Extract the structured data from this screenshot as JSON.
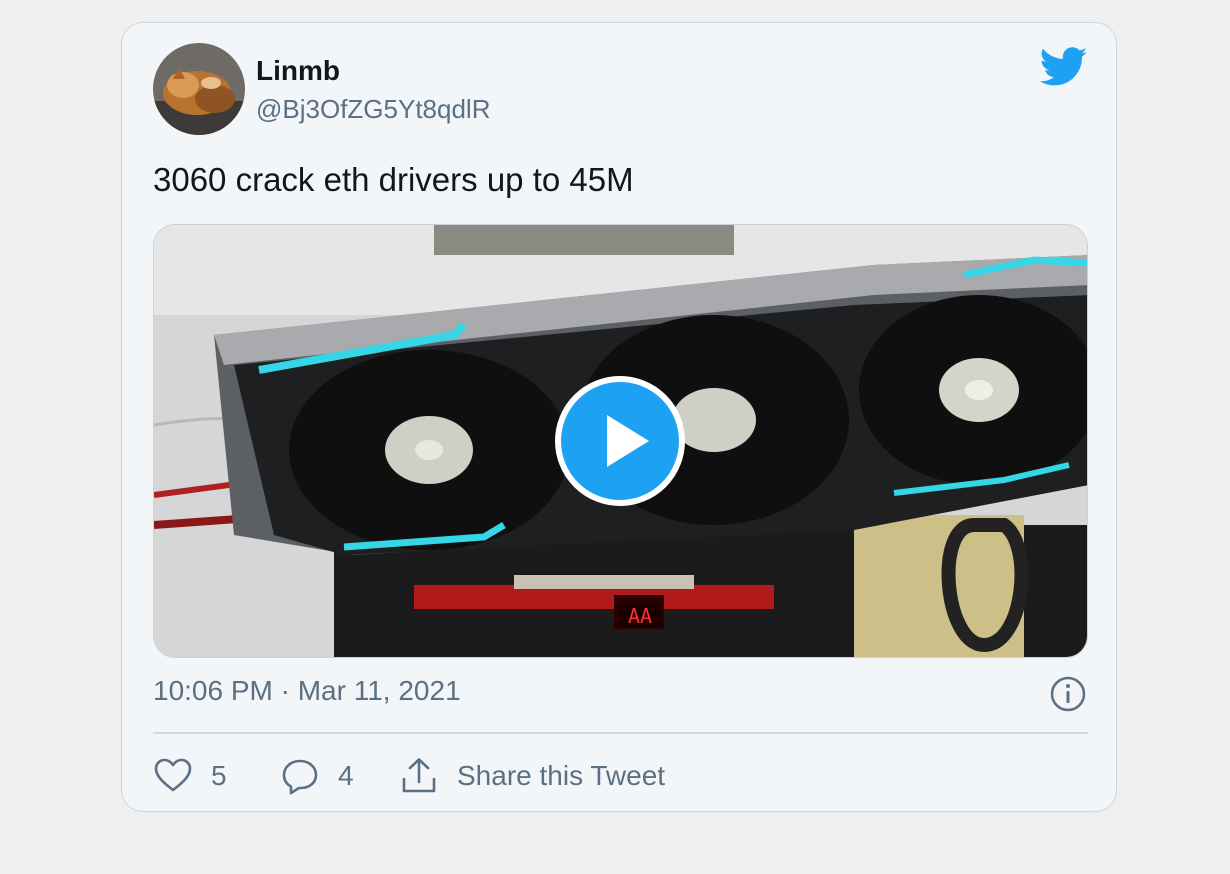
{
  "tweet": {
    "author_name": "Linmb",
    "author_handle": "@Bj3OfZG5Yt8qdlR",
    "text": "3060 crack eth drivers up to 45M",
    "timestamp": "10:06 PM · Mar 11, 2021"
  },
  "actions": {
    "likes": "5",
    "replies": "4",
    "share_label": "Share this Tweet"
  },
  "media": {
    "digit_display": "AA"
  },
  "icons": {
    "brand": "twitter-bird-icon",
    "play": "play-icon",
    "info": "info-icon",
    "like": "heart-icon",
    "reply": "reply-icon",
    "share": "share-icon"
  },
  "colors": {
    "accent": "#1da1f2",
    "secondary_text": "#5b7083",
    "card_background": "#f3f6f9"
  }
}
